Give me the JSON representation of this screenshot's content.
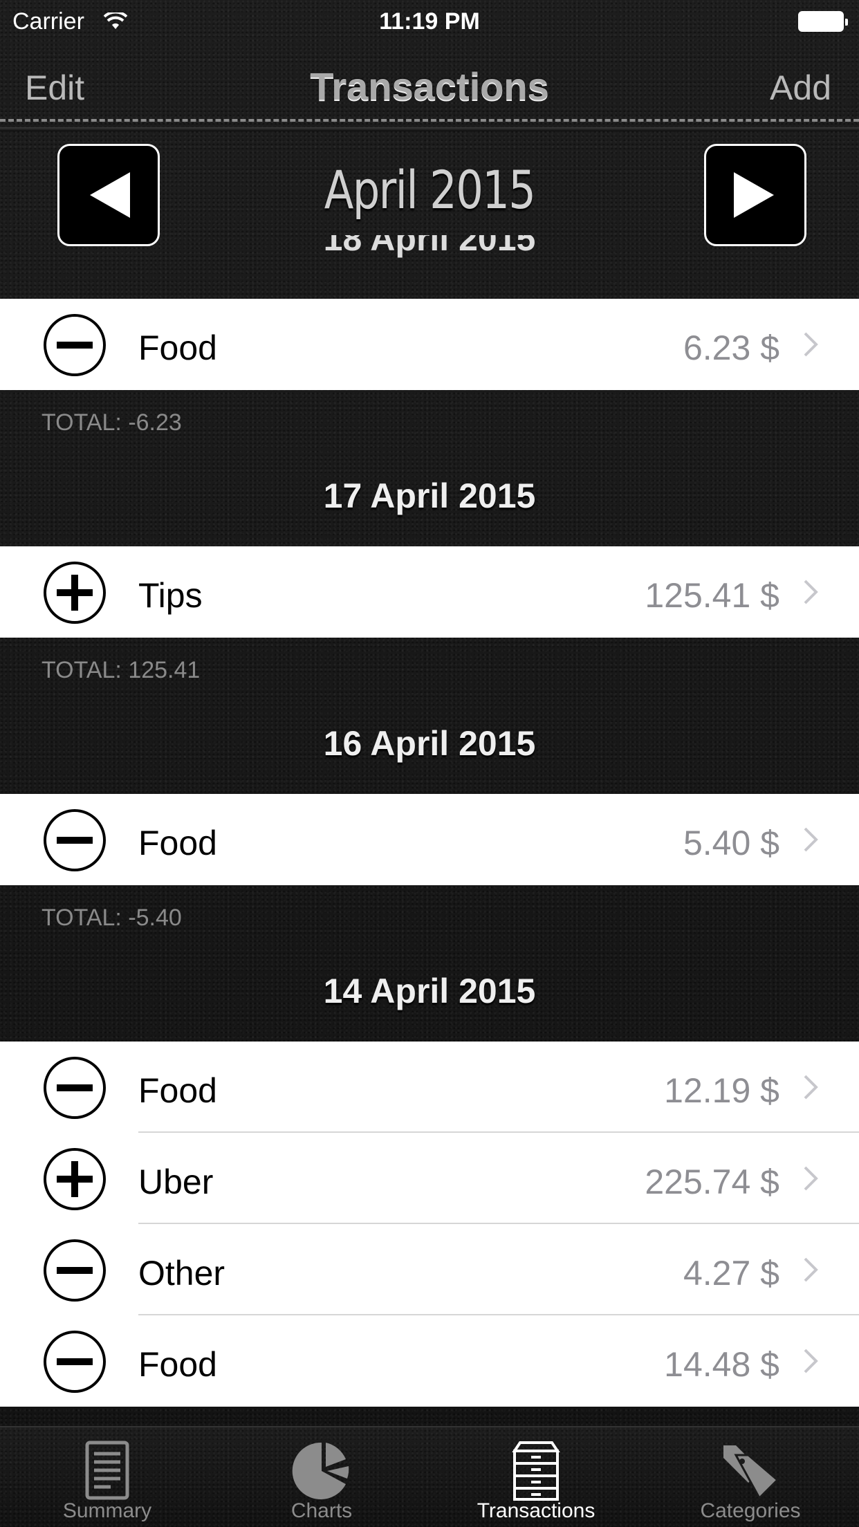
{
  "status_bar": {
    "carrier": "Carrier",
    "time": "11:19 PM"
  },
  "nav": {
    "left_label": "Edit",
    "title": "Transactions",
    "right_label": "Add"
  },
  "month_selector": {
    "title": "April 2015",
    "prev_icon": "triangle-left-icon",
    "next_icon": "triangle-right-icon"
  },
  "peek_header": "18 April 2015",
  "sections": [
    {
      "rows": [
        {
          "type": "minus",
          "category": "Food",
          "amount": "6.23 $"
        }
      ],
      "total": "TOTAL: -6.23",
      "next_header": "17 April 2015"
    },
    {
      "rows": [
        {
          "type": "plus",
          "category": "Tips",
          "amount": "125.41 $"
        }
      ],
      "total": "TOTAL: 125.41",
      "next_header": "16 April 2015"
    },
    {
      "rows": [
        {
          "type": "minus",
          "category": "Food",
          "amount": "5.40 $"
        }
      ],
      "total": "TOTAL: -5.40",
      "next_header": "14 April 2015"
    },
    {
      "rows": [
        {
          "type": "minus",
          "category": "Food",
          "amount": "12.19 $"
        },
        {
          "type": "plus",
          "category": "Uber",
          "amount": "225.74 $"
        },
        {
          "type": "minus",
          "category": "Other",
          "amount": "4.27 $"
        },
        {
          "type": "minus",
          "category": "Food",
          "amount": "14.48 $"
        }
      ]
    }
  ],
  "tabs": [
    {
      "label": "Summary",
      "icon": "document-icon",
      "active": false
    },
    {
      "label": "Charts",
      "icon": "pie-chart-icon",
      "active": false
    },
    {
      "label": "Transactions",
      "icon": "drawer-cabinet-icon",
      "active": true
    },
    {
      "label": "Categories",
      "icon": "tags-icon",
      "active": false
    }
  ],
  "colors": {
    "amount_text": "#8e8e93",
    "total_text": "#8a8a8a",
    "active_tab": "#ffffff",
    "inactive_tab": "#8c8c8c"
  }
}
